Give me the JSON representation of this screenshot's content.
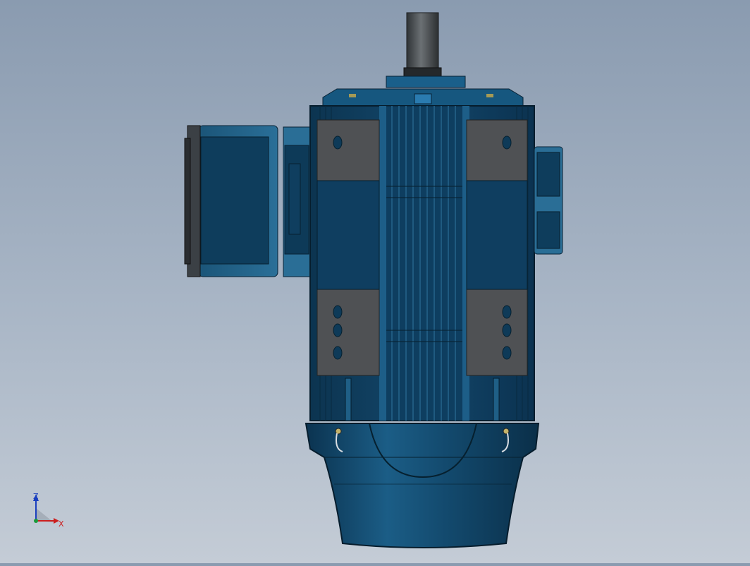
{
  "triad": {
    "z_label": "Z",
    "x_label": "X",
    "z_color": "#1a3fbf",
    "x_color": "#cc1f1f",
    "y_color": "#1a9a3a"
  },
  "model": {
    "body_color": "#0f3c5c",
    "body_highlight": "#1f5f86",
    "pad_color": "#4f5154",
    "shaft_color": "#3d4144",
    "cap_color": "#0e4a70",
    "background_top": "#8a9bb0",
    "background_bottom": "#c4ccd6"
  }
}
